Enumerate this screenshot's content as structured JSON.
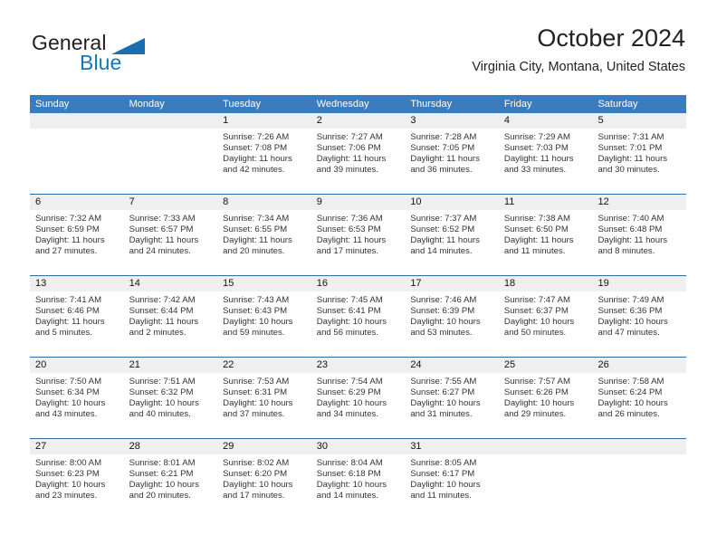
{
  "brand": {
    "name_part1": "General",
    "name_part2": "Blue",
    "triangle_icon": "triangle-icon",
    "accent_blue": "#1277bc",
    "logo_triangle_color": "#1b6cb0"
  },
  "header": {
    "title": "October 2024",
    "subtitle": "Virginia City, Montana, United States"
  },
  "theme": {
    "header_row_bg": "#3a7cbe",
    "header_row_text": "#ffffff",
    "daynum_band_bg": "#efefef",
    "row_divider": "#2f6ca8",
    "body_text": "#333333"
  },
  "weekdays": [
    "Sunday",
    "Monday",
    "Tuesday",
    "Wednesday",
    "Thursday",
    "Friday",
    "Saturday"
  ],
  "weeks": [
    [
      {
        "day": "",
        "lines": []
      },
      {
        "day": "",
        "lines": []
      },
      {
        "day": "1",
        "lines": [
          "Sunrise: 7:26 AM",
          "Sunset: 7:08 PM",
          "Daylight: 11 hours",
          "and 42 minutes."
        ]
      },
      {
        "day": "2",
        "lines": [
          "Sunrise: 7:27 AM",
          "Sunset: 7:06 PM",
          "Daylight: 11 hours",
          "and 39 minutes."
        ]
      },
      {
        "day": "3",
        "lines": [
          "Sunrise: 7:28 AM",
          "Sunset: 7:05 PM",
          "Daylight: 11 hours",
          "and 36 minutes."
        ]
      },
      {
        "day": "4",
        "lines": [
          "Sunrise: 7:29 AM",
          "Sunset: 7:03 PM",
          "Daylight: 11 hours",
          "and 33 minutes."
        ]
      },
      {
        "day": "5",
        "lines": [
          "Sunrise: 7:31 AM",
          "Sunset: 7:01 PM",
          "Daylight: 11 hours",
          "and 30 minutes."
        ]
      }
    ],
    [
      {
        "day": "6",
        "lines": [
          "Sunrise: 7:32 AM",
          "Sunset: 6:59 PM",
          "Daylight: 11 hours",
          "and 27 minutes."
        ]
      },
      {
        "day": "7",
        "lines": [
          "Sunrise: 7:33 AM",
          "Sunset: 6:57 PM",
          "Daylight: 11 hours",
          "and 24 minutes."
        ]
      },
      {
        "day": "8",
        "lines": [
          "Sunrise: 7:34 AM",
          "Sunset: 6:55 PM",
          "Daylight: 11 hours",
          "and 20 minutes."
        ]
      },
      {
        "day": "9",
        "lines": [
          "Sunrise: 7:36 AM",
          "Sunset: 6:53 PM",
          "Daylight: 11 hours",
          "and 17 minutes."
        ]
      },
      {
        "day": "10",
        "lines": [
          "Sunrise: 7:37 AM",
          "Sunset: 6:52 PM",
          "Daylight: 11 hours",
          "and 14 minutes."
        ]
      },
      {
        "day": "11",
        "lines": [
          "Sunrise: 7:38 AM",
          "Sunset: 6:50 PM",
          "Daylight: 11 hours",
          "and 11 minutes."
        ]
      },
      {
        "day": "12",
        "lines": [
          "Sunrise: 7:40 AM",
          "Sunset: 6:48 PM",
          "Daylight: 11 hours",
          "and 8 minutes."
        ]
      }
    ],
    [
      {
        "day": "13",
        "lines": [
          "Sunrise: 7:41 AM",
          "Sunset: 6:46 PM",
          "Daylight: 11 hours",
          "and 5 minutes."
        ]
      },
      {
        "day": "14",
        "lines": [
          "Sunrise: 7:42 AM",
          "Sunset: 6:44 PM",
          "Daylight: 11 hours",
          "and 2 minutes."
        ]
      },
      {
        "day": "15",
        "lines": [
          "Sunrise: 7:43 AM",
          "Sunset: 6:43 PM",
          "Daylight: 10 hours",
          "and 59 minutes."
        ]
      },
      {
        "day": "16",
        "lines": [
          "Sunrise: 7:45 AM",
          "Sunset: 6:41 PM",
          "Daylight: 10 hours",
          "and 56 minutes."
        ]
      },
      {
        "day": "17",
        "lines": [
          "Sunrise: 7:46 AM",
          "Sunset: 6:39 PM",
          "Daylight: 10 hours",
          "and 53 minutes."
        ]
      },
      {
        "day": "18",
        "lines": [
          "Sunrise: 7:47 AM",
          "Sunset: 6:37 PM",
          "Daylight: 10 hours",
          "and 50 minutes."
        ]
      },
      {
        "day": "19",
        "lines": [
          "Sunrise: 7:49 AM",
          "Sunset: 6:36 PM",
          "Daylight: 10 hours",
          "and 47 minutes."
        ]
      }
    ],
    [
      {
        "day": "20",
        "lines": [
          "Sunrise: 7:50 AM",
          "Sunset: 6:34 PM",
          "Daylight: 10 hours",
          "and 43 minutes."
        ]
      },
      {
        "day": "21",
        "lines": [
          "Sunrise: 7:51 AM",
          "Sunset: 6:32 PM",
          "Daylight: 10 hours",
          "and 40 minutes."
        ]
      },
      {
        "day": "22",
        "lines": [
          "Sunrise: 7:53 AM",
          "Sunset: 6:31 PM",
          "Daylight: 10 hours",
          "and 37 minutes."
        ]
      },
      {
        "day": "23",
        "lines": [
          "Sunrise: 7:54 AM",
          "Sunset: 6:29 PM",
          "Daylight: 10 hours",
          "and 34 minutes."
        ]
      },
      {
        "day": "24",
        "lines": [
          "Sunrise: 7:55 AM",
          "Sunset: 6:27 PM",
          "Daylight: 10 hours",
          "and 31 minutes."
        ]
      },
      {
        "day": "25",
        "lines": [
          "Sunrise: 7:57 AM",
          "Sunset: 6:26 PM",
          "Daylight: 10 hours",
          "and 29 minutes."
        ]
      },
      {
        "day": "26",
        "lines": [
          "Sunrise: 7:58 AM",
          "Sunset: 6:24 PM",
          "Daylight: 10 hours",
          "and 26 minutes."
        ]
      }
    ],
    [
      {
        "day": "27",
        "lines": [
          "Sunrise: 8:00 AM",
          "Sunset: 6:23 PM",
          "Daylight: 10 hours",
          "and 23 minutes."
        ]
      },
      {
        "day": "28",
        "lines": [
          "Sunrise: 8:01 AM",
          "Sunset: 6:21 PM",
          "Daylight: 10 hours",
          "and 20 minutes."
        ]
      },
      {
        "day": "29",
        "lines": [
          "Sunrise: 8:02 AM",
          "Sunset: 6:20 PM",
          "Daylight: 10 hours",
          "and 17 minutes."
        ]
      },
      {
        "day": "30",
        "lines": [
          "Sunrise: 8:04 AM",
          "Sunset: 6:18 PM",
          "Daylight: 10 hours",
          "and 14 minutes."
        ]
      },
      {
        "day": "31",
        "lines": [
          "Sunrise: 8:05 AM",
          "Sunset: 6:17 PM",
          "Daylight: 10 hours",
          "and 11 minutes."
        ]
      },
      {
        "day": "",
        "lines": []
      },
      {
        "day": "",
        "lines": []
      }
    ]
  ]
}
